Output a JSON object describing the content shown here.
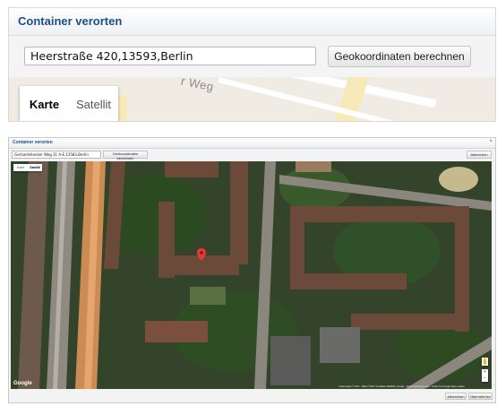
{
  "top": {
    "title": "Container verorten",
    "address_value": "Heerstraße 420,13593,Berlin",
    "geocode_label": "Geokoordinaten berechnen",
    "street_fragment": "r Weg",
    "map_types": [
      {
        "label": "Karte",
        "active": true
      },
      {
        "label": "Satellit",
        "active": false
      }
    ]
  },
  "dialog": {
    "title": "Container verorten",
    "close_label": "×",
    "address_value": "Gerlandshenker Weg 31 A-E,13583,Berlin",
    "geocode_label": "Geokoordinaten berechnen",
    "abbrechen_label": "Abbrechen",
    "map_types": [
      {
        "label": "Karte",
        "active": false
      },
      {
        "label": "Satellit",
        "active": true
      }
    ],
    "map": {
      "google_logo": "Google",
      "attribution": "Kartendaten © 2017 · Bilder ©2017 GeoBasis-DE/BKG, Google · Nutzungsbedingungen · Fehler bei Google Maps melden",
      "zoom_in": "+",
      "zoom_out": "−",
      "marker_color": "#e53935"
    },
    "footer": {
      "abbrechen_label": "Abbrechen",
      "uebernehmen_label": "Übernehmen"
    }
  },
  "colors": {
    "title_blue": "#1d4f86",
    "map_dark_green": "#2d3a24",
    "roof_brown": "#6b4a3a"
  }
}
